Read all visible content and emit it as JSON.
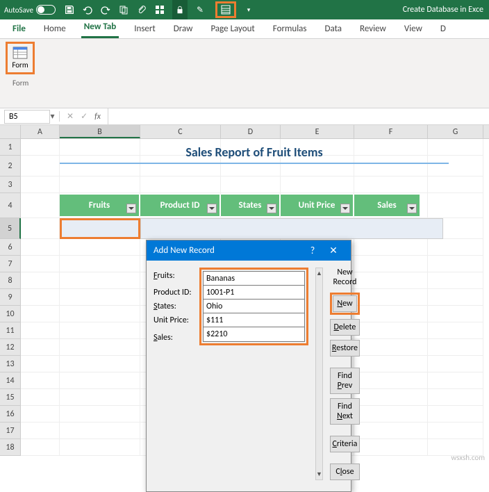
{
  "titlebar": {
    "autosave": "AutoSave",
    "doc_title": "Create Database in Exce"
  },
  "ribbon_tabs": {
    "file": "File",
    "home": "Home",
    "newtab": "New Tab",
    "insert": "Insert",
    "draw": "Draw",
    "page_layout": "Page Layout",
    "formulas": "Formulas",
    "data": "Data",
    "review": "Review",
    "view": "View",
    "dev": "D"
  },
  "ribbon": {
    "form_btn": "Form",
    "form_group": "Form"
  },
  "namebox": {
    "ref": "B5",
    "fx": "fx"
  },
  "columns": [
    "A",
    "B",
    "C",
    "D",
    "E",
    "F",
    "G"
  ],
  "rows": [
    "1",
    "2",
    "3",
    "4",
    "5",
    "6",
    "7",
    "8",
    "9",
    "10",
    "11",
    "12",
    "13",
    "14",
    "15",
    "16",
    "17",
    "18"
  ],
  "report_title": "Sales Report of Fruit Items",
  "table": {
    "headers": {
      "fruits": "Fruits",
      "product_id": "Product ID",
      "states": "States",
      "unit_price": "Unit Price",
      "sales": "Sales"
    }
  },
  "dialog": {
    "title": "Add New Record",
    "help": "?",
    "close": "✕",
    "record_label": "New Record",
    "labels": {
      "fruits": "Fruits:",
      "product_id": "Product ID:",
      "states": "States:",
      "unit_price": "Unit Price:",
      "sales": "Sales:"
    },
    "values": {
      "fruits": "Bananas",
      "product_id": "1001-P1",
      "states": "Ohio",
      "unit_price": "$111",
      "sales": "$2210"
    },
    "buttons": {
      "new": "New",
      "delete": "Delete",
      "restore": "Restore",
      "find_prev": "Find Prev",
      "find_next": "Find Next",
      "criteria": "Criteria",
      "close": "Close"
    }
  },
  "watermark": "wsxsh.com"
}
